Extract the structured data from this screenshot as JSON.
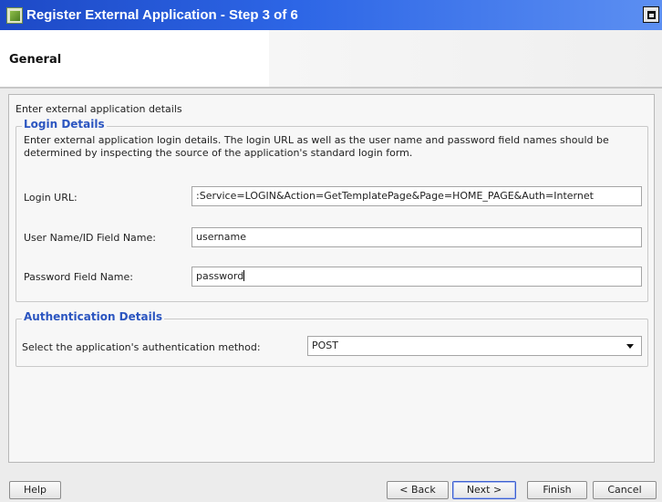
{
  "window": {
    "title": "Register External Application - Step 3 of 6",
    "icon": "app-icon",
    "controls": [
      "maximize-icon"
    ]
  },
  "header": {
    "title": "General"
  },
  "main": {
    "intro": "Enter external application details",
    "login_details": {
      "legend": "Login Details",
      "description": "Enter external application login details. The login URL as well as the user name and password field names should be determined by inspecting the source of the application's standard login form.",
      "login_url_label": "Login URL:",
      "login_url_value": ":Service=LOGIN&Action=GetTemplatePage&Page=HOME_PAGE&Auth=Internet",
      "username_label": "User Name/ID Field Name:",
      "username_value": "username",
      "password_label": "Password Field Name:",
      "password_value": "password"
    },
    "auth_details": {
      "legend": "Authentication Details",
      "method_label": "Select the application's authentication method:",
      "method_value": "POST"
    }
  },
  "footer": {
    "help": "Help",
    "back": "< Back",
    "next": "Next >",
    "finish": "Finish",
    "cancel": "Cancel"
  },
  "colors": {
    "titlebar": "#2d66e6",
    "legend": "#2b55c0"
  }
}
